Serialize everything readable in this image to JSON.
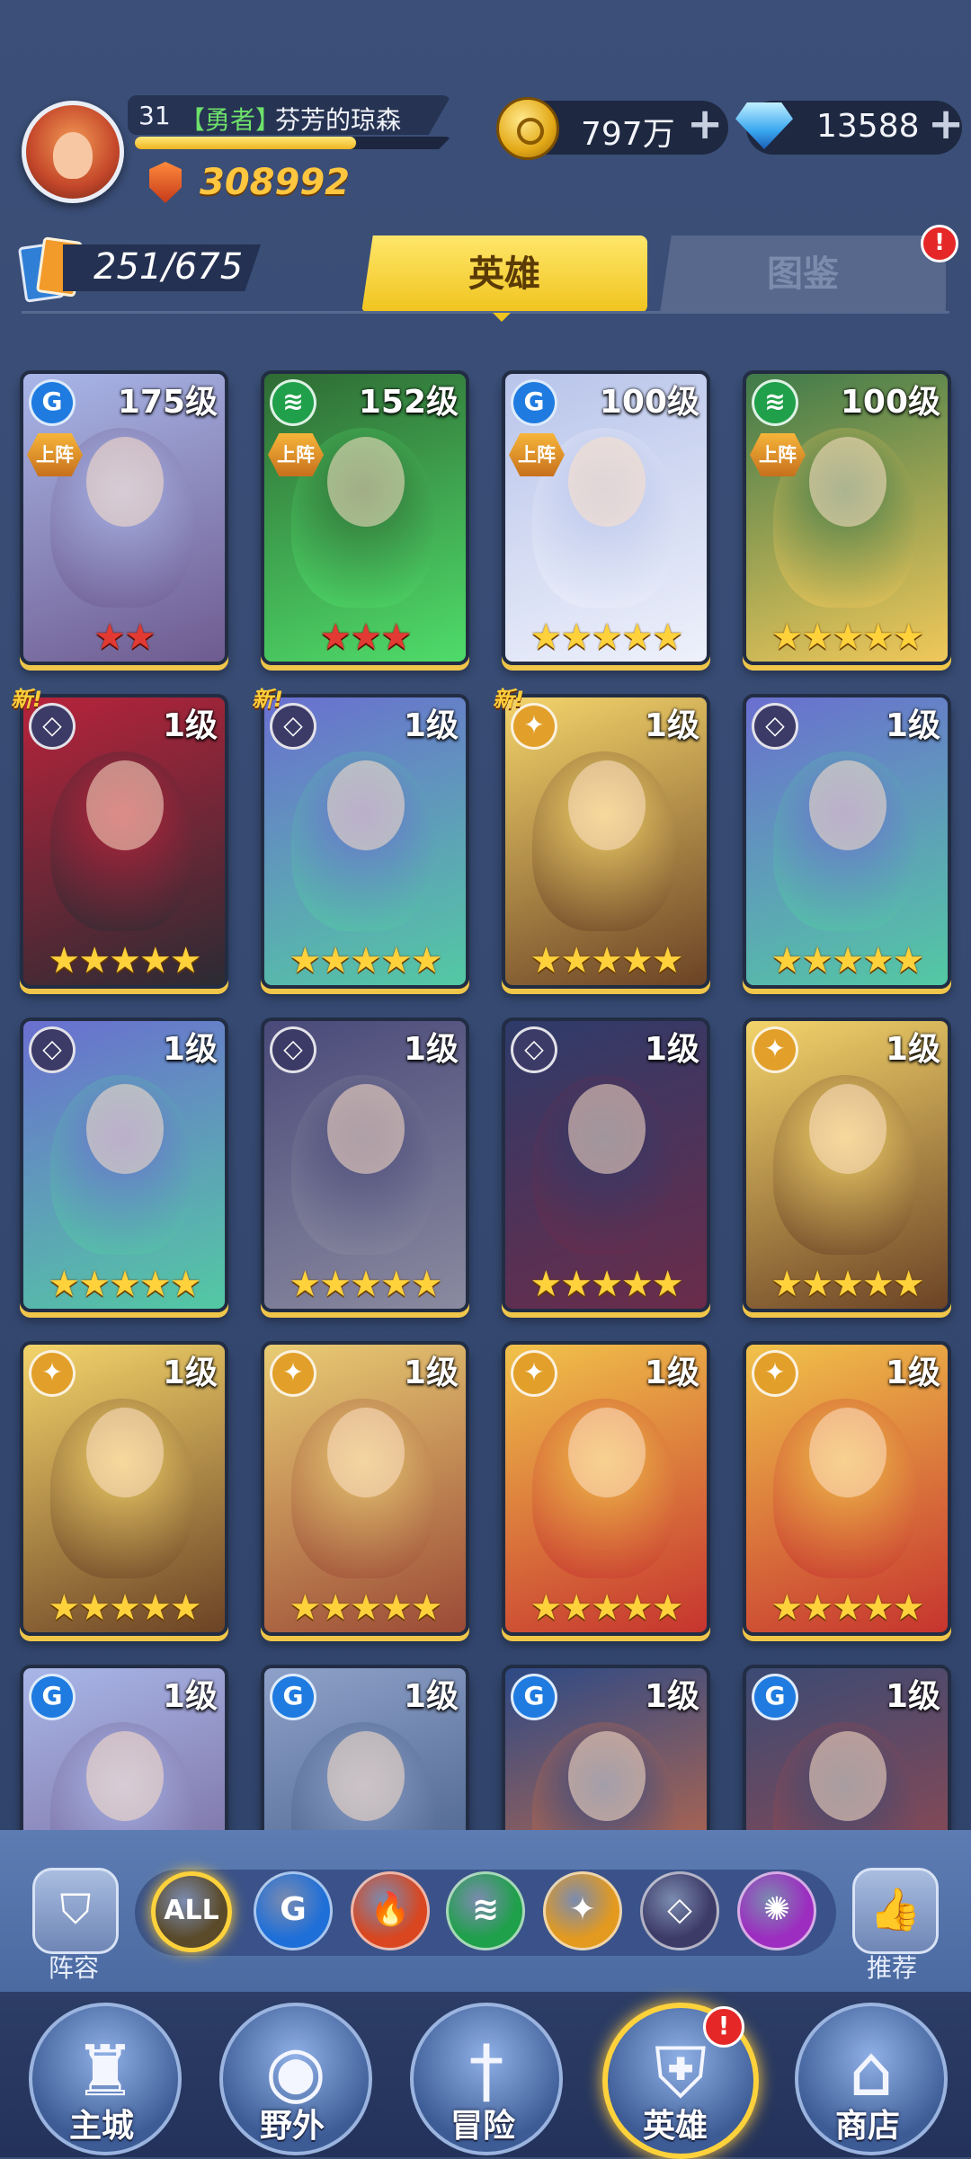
{
  "player": {
    "level": "31",
    "title": "【勇者】",
    "name": "芬芳的琼森",
    "xp_fraction": 0.7,
    "power": "308992"
  },
  "resources": {
    "gold": "797万",
    "gems": "13588",
    "add_symbol": "+"
  },
  "collection": {
    "count": "251/675"
  },
  "tabs": {
    "heroes": "英雄",
    "codex": "图鉴",
    "alert": "!"
  },
  "deployed_label": "上阵",
  "new_label": "新!",
  "heroes": [
    {
      "level": "175级",
      "stars": "★★",
      "star_color": "red",
      "faction": "water",
      "deployed": true,
      "new": false,
      "colors": [
        "#a9b6e8",
        "#6e5b8f"
      ]
    },
    {
      "level": "152级",
      "stars": "★★★",
      "star_color": "red",
      "faction": "wind",
      "deployed": true,
      "new": false,
      "colors": [
        "#2f6b34",
        "#4fdc6a"
      ]
    },
    {
      "level": "100级",
      "stars": "★★★★★",
      "star_color": "gold",
      "faction": "water",
      "deployed": true,
      "new": false,
      "colors": [
        "#b8c4ea",
        "#eef1fb"
      ]
    },
    {
      "level": "100级",
      "stars": "★★★★★",
      "star_color": "gold",
      "faction": "wind",
      "deployed": true,
      "new": false,
      "colors": [
        "#3f7a4a",
        "#f1c85a"
      ]
    },
    {
      "level": "1级",
      "stars": "★★★★★",
      "star_color": "gold",
      "faction": "dark",
      "deployed": false,
      "new": true,
      "colors": [
        "#b8233b",
        "#2b2b33"
      ]
    },
    {
      "level": "1级",
      "stars": "★★★★★",
      "star_color": "gold",
      "faction": "dark",
      "deployed": false,
      "new": true,
      "colors": [
        "#6a6fd0",
        "#53c9a3"
      ]
    },
    {
      "level": "1级",
      "stars": "★★★★★",
      "star_color": "gold",
      "faction": "light",
      "deployed": false,
      "new": true,
      "colors": [
        "#f3d46a",
        "#6b4326"
      ]
    },
    {
      "level": "1级",
      "stars": "★★★★★",
      "star_color": "gold",
      "faction": "dark",
      "deployed": false,
      "new": false,
      "colors": [
        "#6a6fd0",
        "#53c9a3"
      ]
    },
    {
      "level": "1级",
      "stars": "★★★★★",
      "star_color": "gold",
      "faction": "dark",
      "deployed": false,
      "new": false,
      "colors": [
        "#6a6fd0",
        "#53c9a3"
      ]
    },
    {
      "level": "1级",
      "stars": "★★★★★",
      "star_color": "gold",
      "faction": "dark",
      "deployed": false,
      "new": false,
      "colors": [
        "#4a4a7a",
        "#8a8aa0"
      ]
    },
    {
      "level": "1级",
      "stars": "★★★★★",
      "star_color": "gold",
      "faction": "dark",
      "deployed": false,
      "new": false,
      "colors": [
        "#2e3b6a",
        "#6b2c4a"
      ]
    },
    {
      "level": "1级",
      "stars": "★★★★★",
      "star_color": "gold",
      "faction": "light",
      "deployed": false,
      "new": false,
      "colors": [
        "#f3d46a",
        "#6b4326"
      ]
    },
    {
      "level": "1级",
      "stars": "★★★★★",
      "star_color": "gold",
      "faction": "light",
      "deployed": false,
      "new": false,
      "colors": [
        "#f3d46a",
        "#6b4326"
      ]
    },
    {
      "level": "1级",
      "stars": "★★★★★",
      "star_color": "gold",
      "faction": "light",
      "deployed": false,
      "new": false,
      "colors": [
        "#e9cc74",
        "#9b4a36"
      ]
    },
    {
      "level": "1级",
      "stars": "★★★★★",
      "star_color": "gold",
      "faction": "light",
      "deployed": false,
      "new": false,
      "colors": [
        "#f1c24a",
        "#c6342f"
      ]
    },
    {
      "level": "1级",
      "stars": "★★★★★",
      "star_color": "gold",
      "faction": "light",
      "deployed": false,
      "new": false,
      "colors": [
        "#f1c24a",
        "#c6342f"
      ]
    },
    {
      "level": "1级",
      "stars": "",
      "star_color": "gold",
      "faction": "water",
      "deployed": false,
      "new": false,
      "colors": [
        "#a9b6e8",
        "#6e5b8f"
      ]
    },
    {
      "level": "1级",
      "stars": "",
      "star_color": "gold",
      "faction": "water",
      "deployed": false,
      "new": false,
      "colors": [
        "#8ea1c9",
        "#38517a"
      ]
    },
    {
      "level": "1级",
      "stars": "",
      "star_color": "gold",
      "faction": "water",
      "deployed": false,
      "new": false,
      "colors": [
        "#2d4a86",
        "#e2703a"
      ]
    },
    {
      "level": "1级",
      "stars": "",
      "star_color": "gold",
      "faction": "water",
      "deployed": false,
      "new": false,
      "colors": [
        "#3b4a74",
        "#a64848"
      ]
    }
  ],
  "faction_styles": {
    "water": {
      "bg": "#1f7be0",
      "glyph": "G"
    },
    "wind": {
      "bg": "#20a04a",
      "glyph": "≋"
    },
    "dark": {
      "bg": "#3c3a66",
      "glyph": "◇"
    },
    "light": {
      "bg": "#e2a02a",
      "glyph": "✦"
    }
  },
  "filters": {
    "lineup_label": "阵容",
    "recommend_label": "推荐",
    "buttons": [
      {
        "id": "all",
        "label": "ALL",
        "color": "#5a4a2a",
        "active": true
      },
      {
        "id": "water",
        "label": "G",
        "color": "#1f6fd8",
        "active": false
      },
      {
        "id": "fire",
        "label": "🔥",
        "color": "#d9461f",
        "active": false
      },
      {
        "id": "wind",
        "label": "≋",
        "color": "#1fa04a",
        "active": false
      },
      {
        "id": "light",
        "label": "✦",
        "color": "#e39a1f",
        "active": false
      },
      {
        "id": "dark",
        "label": "◇",
        "color": "#3c3a66",
        "active": false
      },
      {
        "id": "arcane",
        "label": "✺",
        "color": "#9d2cc0",
        "active": false
      }
    ]
  },
  "nav": {
    "items": [
      {
        "label": "主城",
        "icon": "castle-icon",
        "glyph": "♜",
        "active": false
      },
      {
        "label": "野外",
        "icon": "portal-icon",
        "glyph": "◉",
        "active": false
      },
      {
        "label": "冒险",
        "icon": "sword-icon",
        "glyph": "†",
        "active": false
      },
      {
        "label": "英雄",
        "icon": "knight-helmet-icon",
        "glyph": "⛨",
        "active": true
      },
      {
        "label": "商店",
        "icon": "shop-icon",
        "glyph": "⌂",
        "active": false
      }
    ],
    "alert": "!"
  }
}
